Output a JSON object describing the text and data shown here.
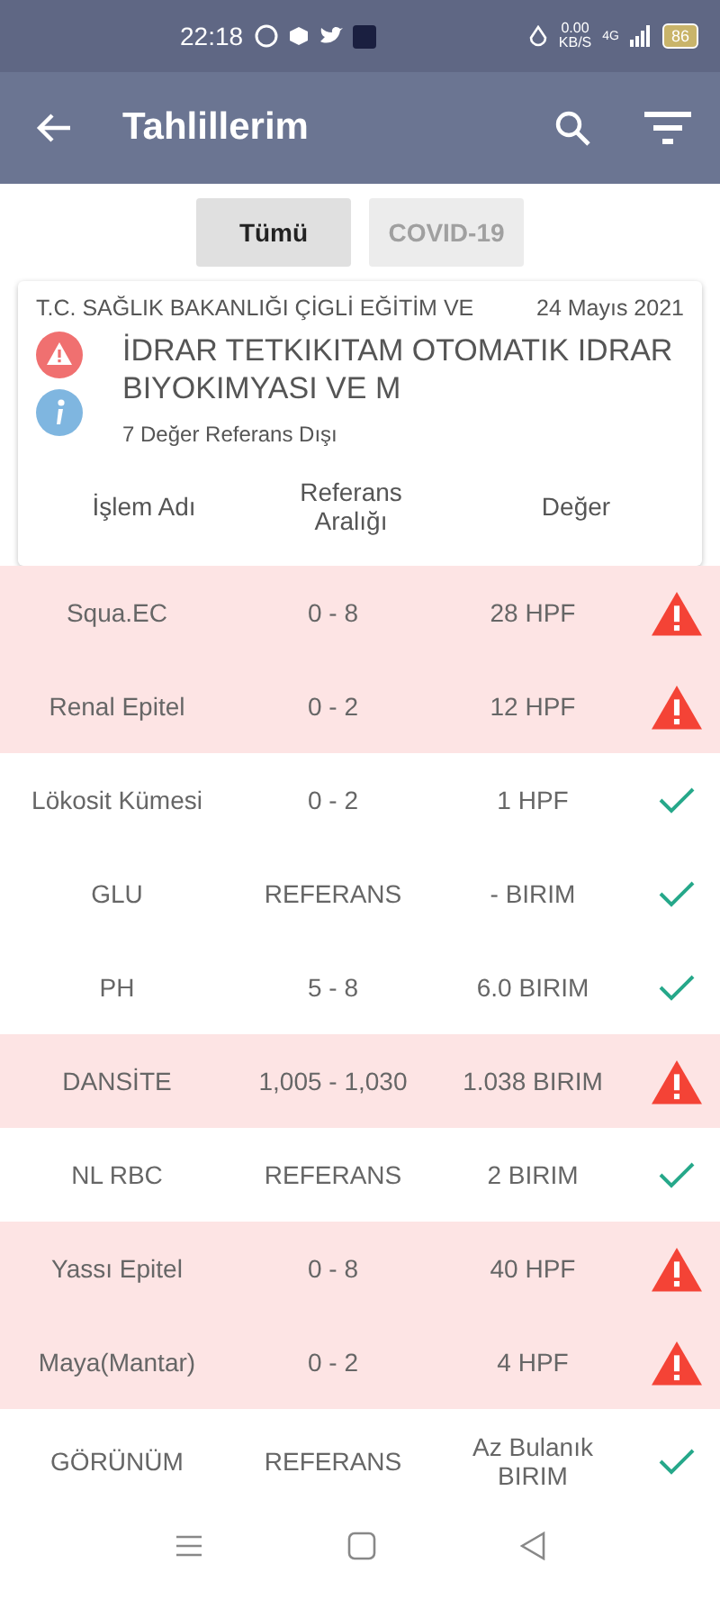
{
  "status_bar": {
    "time": "22:18",
    "speed": "0.00",
    "speed_unit": "KB/S",
    "network": "4G",
    "battery": "86"
  },
  "app_bar": {
    "title": "Tahlillerim"
  },
  "tabs": [
    {
      "label": "Tümü",
      "selected": true
    },
    {
      "label": "COVID-19",
      "selected": false
    }
  ],
  "report": {
    "institution": "T.C. SAĞLIK BAKANLIĞI ÇİGLİ EĞİTİM VE",
    "date": "24 Mayıs 2021",
    "title": "İDRAR TETKIKITAM OTOMATIK IDRAR BIYOKIMYASI VE M",
    "summary": "7 Değer Referans Dışı"
  },
  "table": {
    "columns": [
      "İşlem Adı",
      "Referans Aralığı",
      "Değer"
    ],
    "rows": [
      {
        "name": "Squa.EC",
        "range": "0 - 8",
        "value": "28 HPF",
        "abnormal": true
      },
      {
        "name": "Renal Epitel",
        "range": "0 - 2",
        "value": "12 HPF",
        "abnormal": true
      },
      {
        "name": "Lökosit Kümesi",
        "range": "0 - 2",
        "value": "1 HPF",
        "abnormal": false
      },
      {
        "name": "GLU",
        "range": "REFERANS",
        "value": "- BIRIM",
        "abnormal": false
      },
      {
        "name": "PH",
        "range": "5 - 8",
        "value": "6.0 BIRIM",
        "abnormal": false
      },
      {
        "name": "DANSİTE",
        "range": "1,005 - 1,030",
        "value": "1.038 BIRIM",
        "abnormal": true
      },
      {
        "name": "NL RBC",
        "range": "REFERANS",
        "value": "2 BIRIM",
        "abnormal": false
      },
      {
        "name": "Yassı Epitel",
        "range": "0 - 8",
        "value": "40 HPF",
        "abnormal": true
      },
      {
        "name": "Maya(Mantar)",
        "range": "0 - 2",
        "value": "4 HPF",
        "abnormal": true
      },
      {
        "name": "GÖRÜNÜM",
        "range": "REFERANS",
        "value": "Az Bulanık BIRIM",
        "abnormal": false
      }
    ]
  }
}
